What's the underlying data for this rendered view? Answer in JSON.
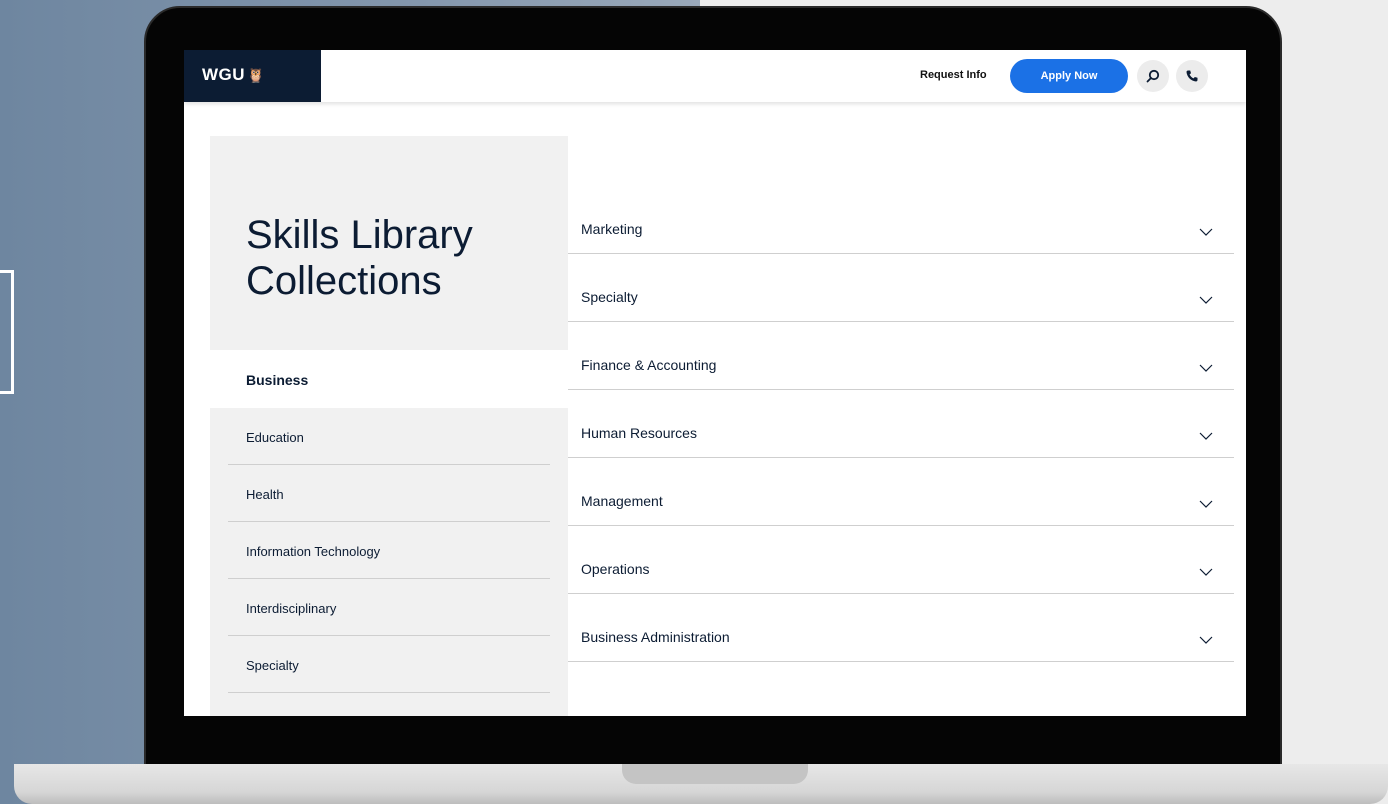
{
  "header": {
    "logo_text": "WGU",
    "request_info_label": "Request Info",
    "apply_now_label": "Apply Now"
  },
  "hero": {
    "title_line1": "Skills Library",
    "title_line2": "Collections"
  },
  "sidebar": {
    "active_item": "Business",
    "items": [
      {
        "label": "Education"
      },
      {
        "label": "Health"
      },
      {
        "label": "Information Technology"
      },
      {
        "label": "Interdisciplinary"
      },
      {
        "label": "Specialty"
      }
    ]
  },
  "accordion": {
    "items": [
      {
        "label": "Marketing"
      },
      {
        "label": "Specialty"
      },
      {
        "label": "Finance & Accounting"
      },
      {
        "label": "Human Resources"
      },
      {
        "label": "Management"
      },
      {
        "label": "Operations"
      },
      {
        "label": "Business Administration"
      }
    ]
  },
  "colors": {
    "brand_navy": "#0c1c33",
    "accent_blue": "#1b71e6",
    "panel_gray": "#f1f1f1"
  }
}
